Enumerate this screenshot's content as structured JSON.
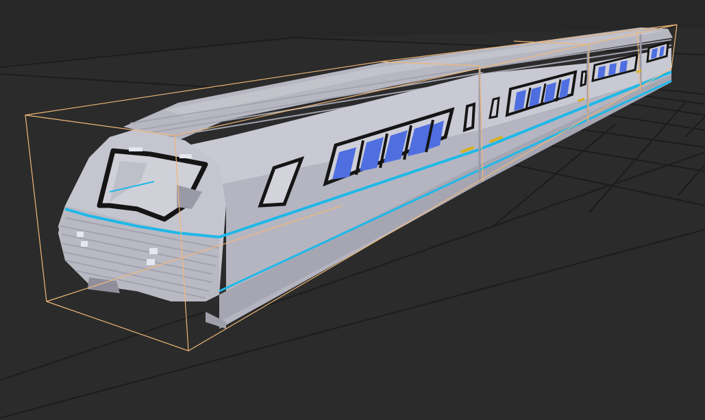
{
  "scene": {
    "model_icon": "voxel-train-model",
    "colors": {
      "background": "#2b2b2b",
      "grid_line": "#1a1a1a",
      "selection_box": "#f0b878",
      "body_light": "#c8c8d2",
      "body_mid": "#b0b0bc",
      "body_dark": "#9898a6",
      "stripe": "#1fb8e8",
      "window_frame": "#151515",
      "seat_blue": "#4f6fe0",
      "hazard_stripe": "#d8b020"
    }
  }
}
